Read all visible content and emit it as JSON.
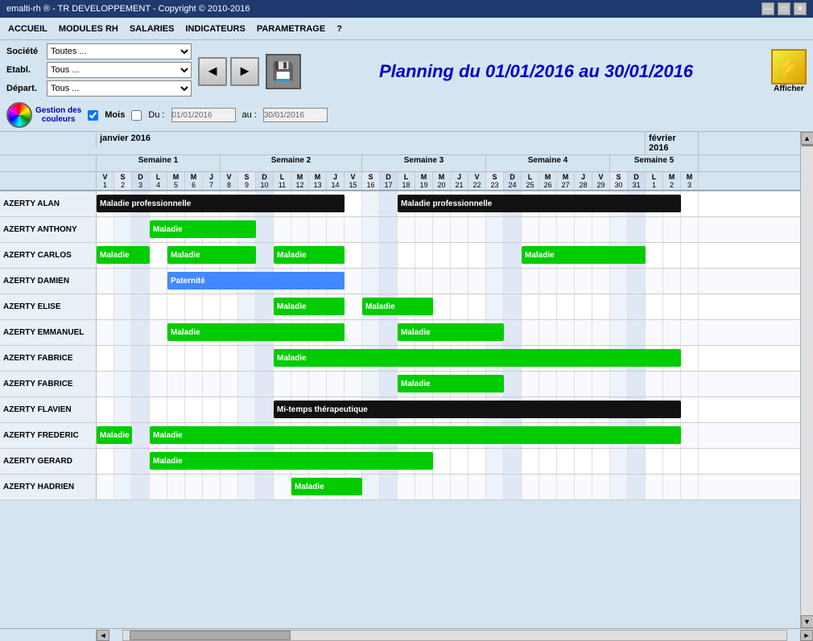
{
  "titleBar": {
    "title": "emalti-rh ® - TR DEVELOPPEMENT - Copyright © 2010-2016",
    "minBtn": "—",
    "maxBtn": "□",
    "closeBtn": "✕"
  },
  "menuBar": {
    "items": [
      {
        "id": "accueil",
        "label": "ACCUEIL"
      },
      {
        "id": "modules-rh",
        "label": "MODULES RH"
      },
      {
        "id": "salaries",
        "label": "SALARIES"
      },
      {
        "id": "indicateurs",
        "label": "INDICATEURS"
      },
      {
        "id": "parametrage",
        "label": "PARAMETRAGE"
      },
      {
        "id": "aide",
        "label": "?"
      }
    ]
  },
  "toolbar": {
    "societe_label": "Société",
    "societe_value": "Toutes ...",
    "etabl_label": "Etabl.",
    "etabl_value": "Tous ...",
    "depart_label": "Départ.",
    "depart_value": "Tous ...",
    "gestion_couleurs": "Gestion des\ncouleurs",
    "mois_label": "Mois",
    "du_label": "Du :",
    "au_label": "au :",
    "date_from": "01/01/2016",
    "date_to": "30/01/2016",
    "planning_title": "Planning du 01/01/2016 au 30/01/2016",
    "afficher_label": "Afficher"
  },
  "calendar": {
    "months": [
      {
        "label": "janvier 2016",
        "cols": 31
      },
      {
        "label": "février 2016",
        "cols": 3
      }
    ],
    "weeks": [
      {
        "label": "Semaine 1",
        "days": 7
      },
      {
        "label": "Semaine 2",
        "days": 7
      },
      {
        "label": "Semaine 3",
        "days": 7
      },
      {
        "label": "Semaine 4",
        "days": 7
      },
      {
        "label": "Semaine 5",
        "days": 3
      }
    ],
    "days": [
      {
        "letter": "V",
        "num": "1",
        "weekend": false
      },
      {
        "letter": "S",
        "num": "2",
        "weekend": true
      },
      {
        "letter": "D",
        "num": "3",
        "weekend": true
      },
      {
        "letter": "L",
        "num": "4",
        "weekend": false
      },
      {
        "letter": "M",
        "num": "5",
        "weekend": false
      },
      {
        "letter": "M",
        "num": "6",
        "weekend": false
      },
      {
        "letter": "J",
        "num": "7",
        "weekend": false
      },
      {
        "letter": "V",
        "num": "8",
        "weekend": false
      },
      {
        "letter": "S",
        "num": "9",
        "weekend": true
      },
      {
        "letter": "D",
        "num": "10",
        "weekend": true
      },
      {
        "letter": "L",
        "num": "11",
        "weekend": false
      },
      {
        "letter": "M",
        "num": "12",
        "weekend": false
      },
      {
        "letter": "M",
        "num": "13",
        "weekend": false
      },
      {
        "letter": "J",
        "num": "14",
        "weekend": false
      },
      {
        "letter": "V",
        "num": "15",
        "weekend": false
      },
      {
        "letter": "S",
        "num": "16",
        "weekend": true
      },
      {
        "letter": "D",
        "num": "17",
        "weekend": true
      },
      {
        "letter": "L",
        "num": "18",
        "weekend": false
      },
      {
        "letter": "M",
        "num": "19",
        "weekend": false
      },
      {
        "letter": "M",
        "num": "20",
        "weekend": false
      },
      {
        "letter": "J",
        "num": "21",
        "weekend": false
      },
      {
        "letter": "V",
        "num": "22",
        "weekend": false
      },
      {
        "letter": "S",
        "num": "23",
        "weekend": true
      },
      {
        "letter": "D",
        "num": "24",
        "weekend": true
      },
      {
        "letter": "L",
        "num": "25",
        "weekend": false
      },
      {
        "letter": "M",
        "num": "26",
        "weekend": false
      },
      {
        "letter": "M",
        "num": "27",
        "weekend": false
      },
      {
        "letter": "J",
        "num": "28",
        "weekend": false
      },
      {
        "letter": "V",
        "num": "29",
        "weekend": false
      },
      {
        "letter": "S",
        "num": "30",
        "weekend": true
      },
      {
        "letter": "D",
        "num": "31",
        "weekend": true
      },
      {
        "letter": "L",
        "num": "1",
        "weekend": false
      },
      {
        "letter": "M",
        "num": "2",
        "weekend": false
      },
      {
        "letter": "M",
        "num": "3",
        "weekend": false
      }
    ],
    "employees": [
      {
        "name": "AZERTY ALAN",
        "events": [
          {
            "label": "Maladie professionnelle",
            "type": "black",
            "startDay": 0,
            "endDay": 14
          },
          {
            "label": "Maladie professionnelle",
            "type": "black",
            "startDay": 17,
            "endDay": 33
          }
        ]
      },
      {
        "name": "AZERTY ANTHONY",
        "events": [
          {
            "label": "Maladie",
            "type": "green",
            "startDay": 3,
            "endDay": 9
          }
        ]
      },
      {
        "name": "AZERTY CARLOS",
        "events": [
          {
            "label": "Maladie",
            "type": "green",
            "startDay": 0,
            "endDay": 3
          },
          {
            "label": "Maladie",
            "type": "green",
            "startDay": 4,
            "endDay": 9
          },
          {
            "label": "Maladie",
            "type": "green",
            "startDay": 10,
            "endDay": 14
          },
          {
            "label": "Maladie",
            "type": "green",
            "startDay": 24,
            "endDay": 31
          }
        ]
      },
      {
        "name": "AZERTY DAMIEN",
        "events": [
          {
            "label": "Paternité",
            "type": "blue",
            "startDay": 4,
            "endDay": 14
          }
        ]
      },
      {
        "name": "AZERTY ELISE",
        "events": [
          {
            "label": "Maladie",
            "type": "green",
            "startDay": 10,
            "endDay": 14
          },
          {
            "label": "Maladie",
            "type": "green",
            "startDay": 15,
            "endDay": 19
          }
        ]
      },
      {
        "name": "AZERTY EMMANUEL",
        "events": [
          {
            "label": "Maladie",
            "type": "green",
            "startDay": 4,
            "endDay": 14
          },
          {
            "label": "Maladie",
            "type": "green",
            "startDay": 17,
            "endDay": 23
          }
        ]
      },
      {
        "name": "AZERTY FABRICE",
        "events": [
          {
            "label": "Maladie",
            "type": "green",
            "startDay": 10,
            "endDay": 33
          }
        ]
      },
      {
        "name": "AZERTY FABRICE",
        "events": [
          {
            "label": "Maladie",
            "type": "green",
            "startDay": 17,
            "endDay": 23
          }
        ]
      },
      {
        "name": "AZERTY FLAVIEN",
        "events": [
          {
            "label": "Mi-temps thérapeutique",
            "type": "black",
            "startDay": 10,
            "endDay": 33
          }
        ]
      },
      {
        "name": "AZERTY FREDERIC",
        "events": [
          {
            "label": "Maladie",
            "type": "green",
            "startDay": 0,
            "endDay": 2
          },
          {
            "label": "Maladie",
            "type": "green",
            "startDay": 3,
            "endDay": 33
          }
        ]
      },
      {
        "name": "AZERTY GERARD",
        "events": [
          {
            "label": "Maladie",
            "type": "green",
            "startDay": 3,
            "endDay": 19
          }
        ]
      },
      {
        "name": "AZERTY HADRIEN",
        "events": [
          {
            "label": "Maladie",
            "type": "green",
            "startDay": 11,
            "endDay": 15
          }
        ]
      }
    ]
  }
}
